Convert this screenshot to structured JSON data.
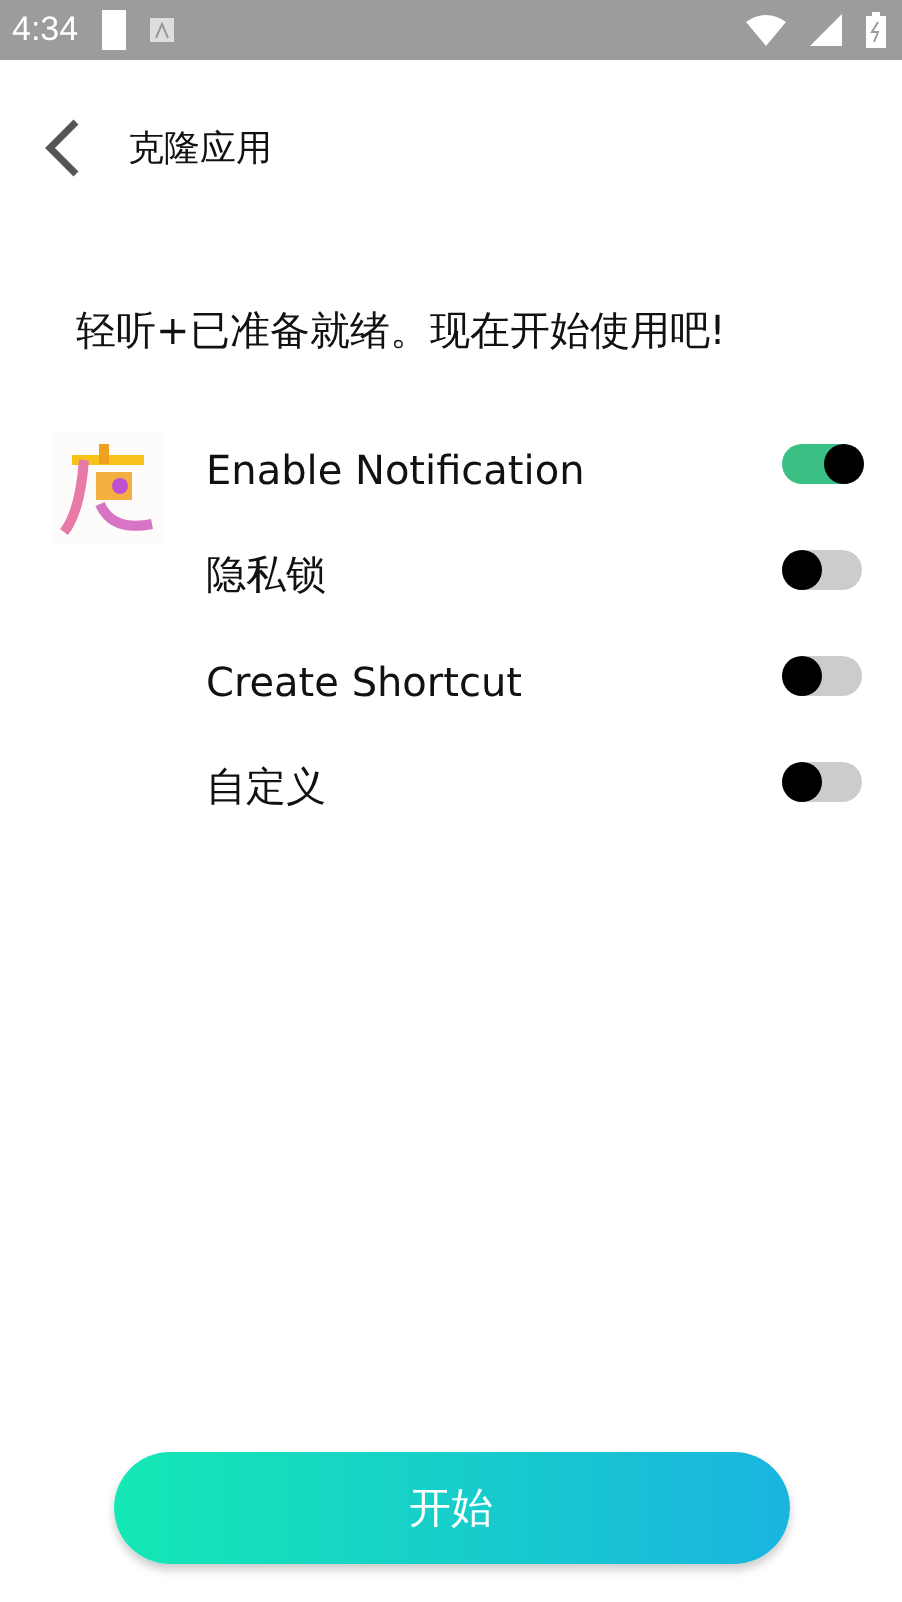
{
  "status_bar": {
    "time": "4:34"
  },
  "header": {
    "title": "克隆应用"
  },
  "message": "轻听+已准备就绪。现在开始使用吧!",
  "options": [
    {
      "label": "Enable Notification",
      "on": true
    },
    {
      "label": "隐私锁",
      "on": false
    },
    {
      "label": "Create Shortcut",
      "on": false
    },
    {
      "label": "自定义",
      "on": false
    }
  ],
  "start_button": {
    "label": "开始"
  }
}
